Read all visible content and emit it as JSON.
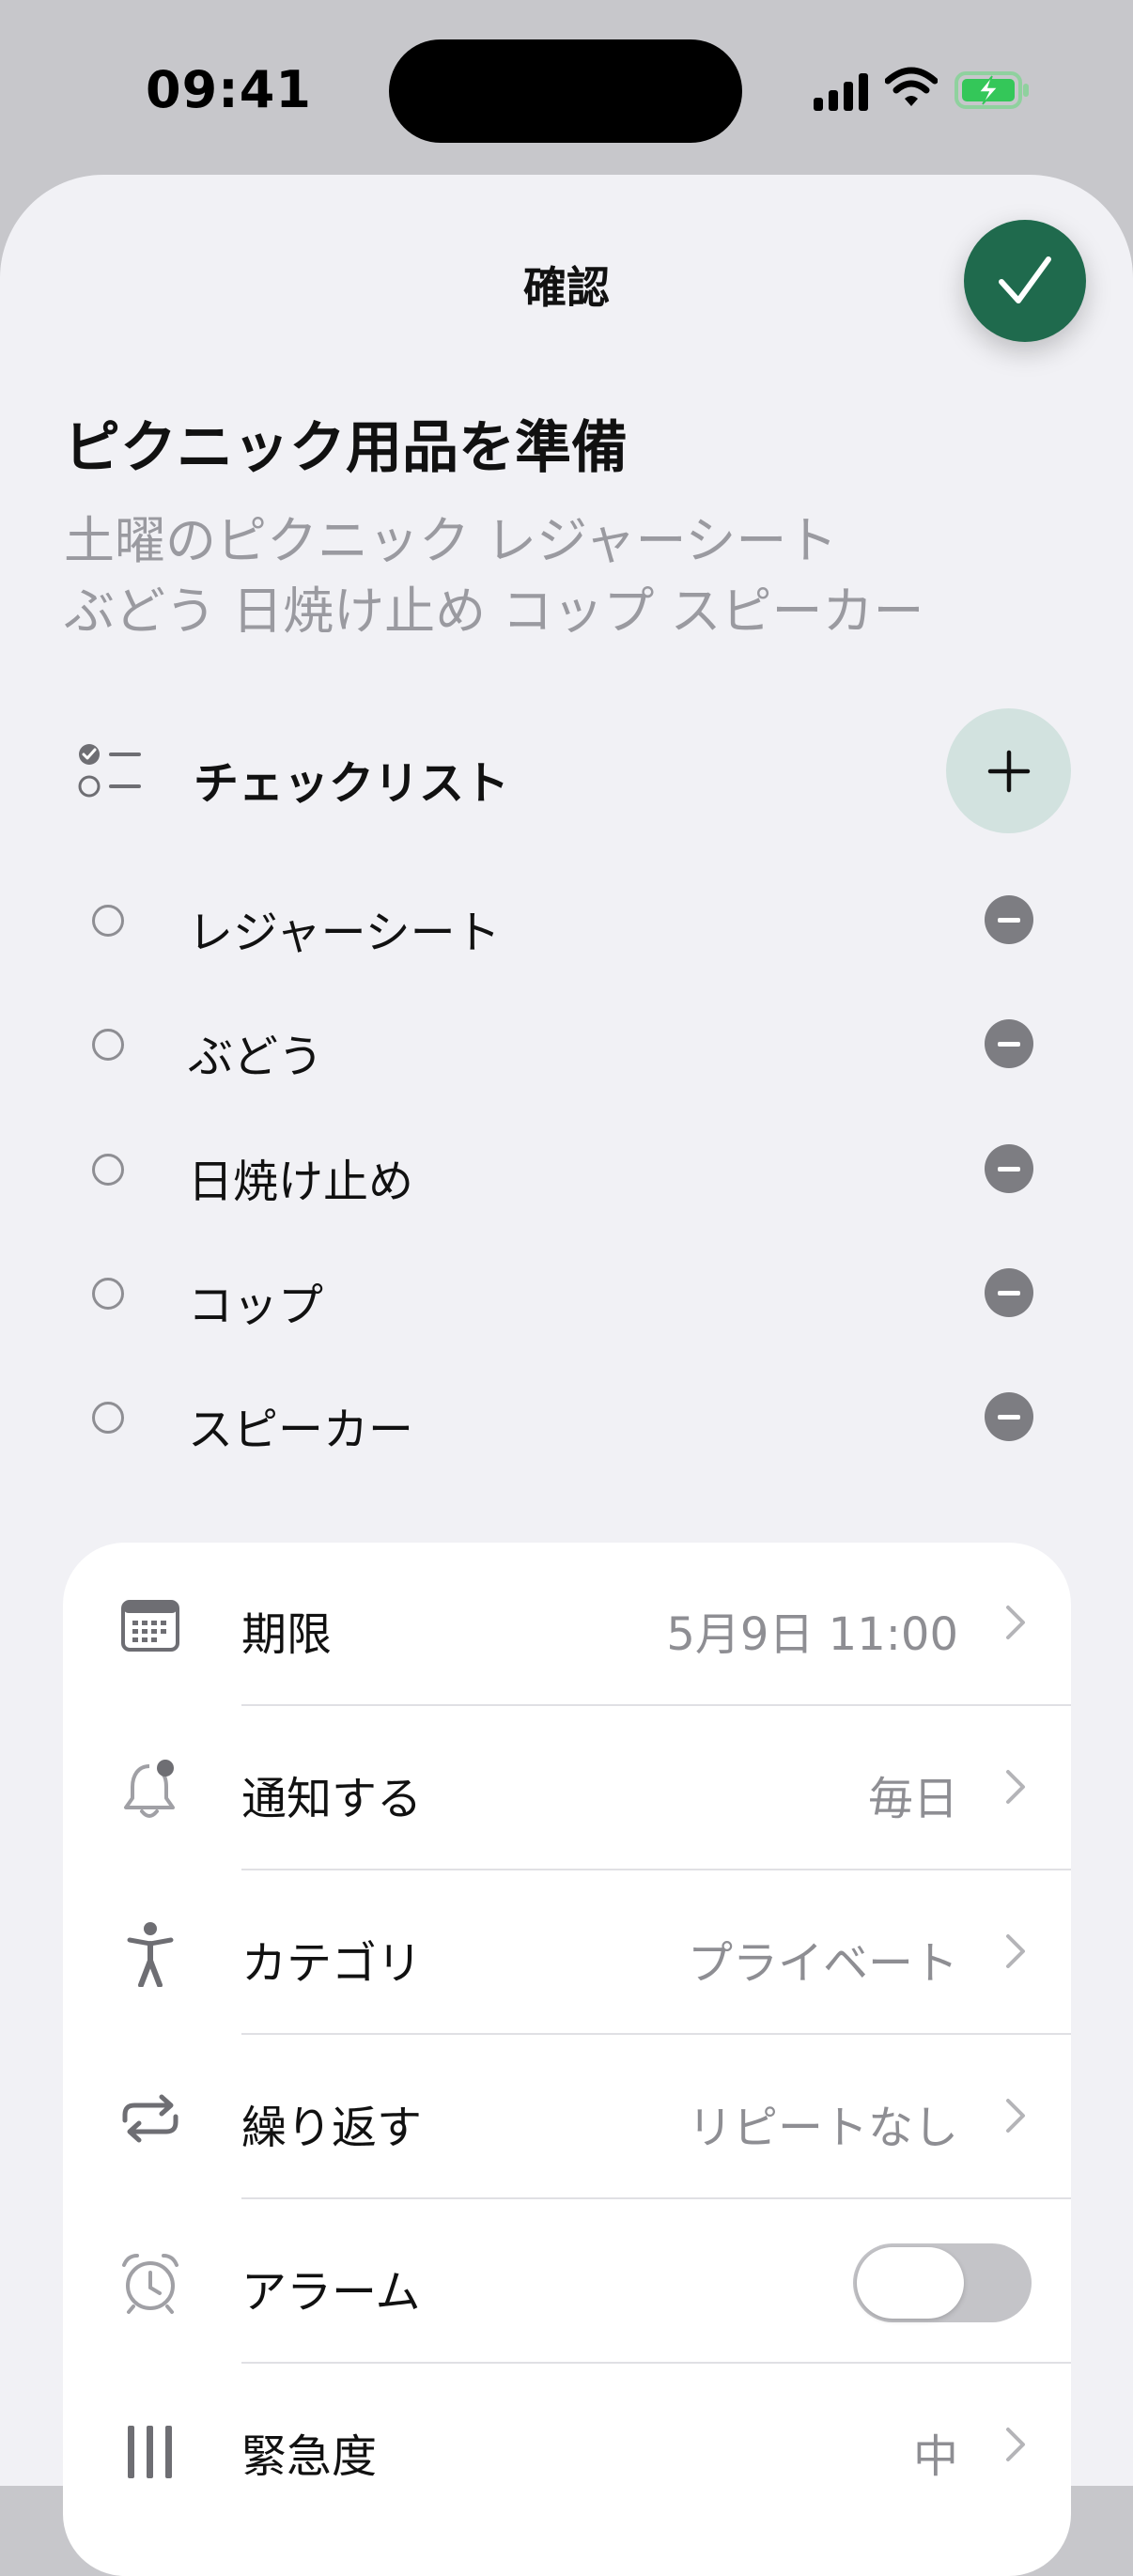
{
  "status_bar": {
    "time": "09:41"
  },
  "sheet": {
    "title": "確認",
    "task_title": "ピクニック用品を準備",
    "description_lines": [
      "土曜のピクニック レジャーシート",
      "ぶどう 日焼け止め コップ スピーカー"
    ]
  },
  "checklist": {
    "label": "チェックリスト",
    "items": [
      {
        "label": "レジャーシート"
      },
      {
        "label": "ぶどう"
      },
      {
        "label": "日焼け止め"
      },
      {
        "label": "コップ"
      },
      {
        "label": "スピーカー"
      }
    ]
  },
  "settings": {
    "due": {
      "label": "期限",
      "value": "5月9日 11:00",
      "icon": "calendar-icon"
    },
    "notify": {
      "label": "通知する",
      "value": "毎日",
      "icon": "bell-icon"
    },
    "category": {
      "label": "カテゴリ",
      "value": "プライベート",
      "icon": "person-icon"
    },
    "repeat": {
      "label": "繰り返す",
      "value": "リピートなし",
      "icon": "repeat-icon"
    },
    "alarm": {
      "label": "アラーム",
      "enabled": false,
      "icon": "alarm-clock-icon"
    },
    "priority": {
      "label": "緊急度",
      "value": "中",
      "icon": "priority-bars-icon"
    }
  },
  "colors": {
    "accent": "#1f6a4d",
    "add_button_bg": "#d2e2df",
    "sheet_bg": "#f1f1f5",
    "secondary_text": "#8e8e93"
  }
}
